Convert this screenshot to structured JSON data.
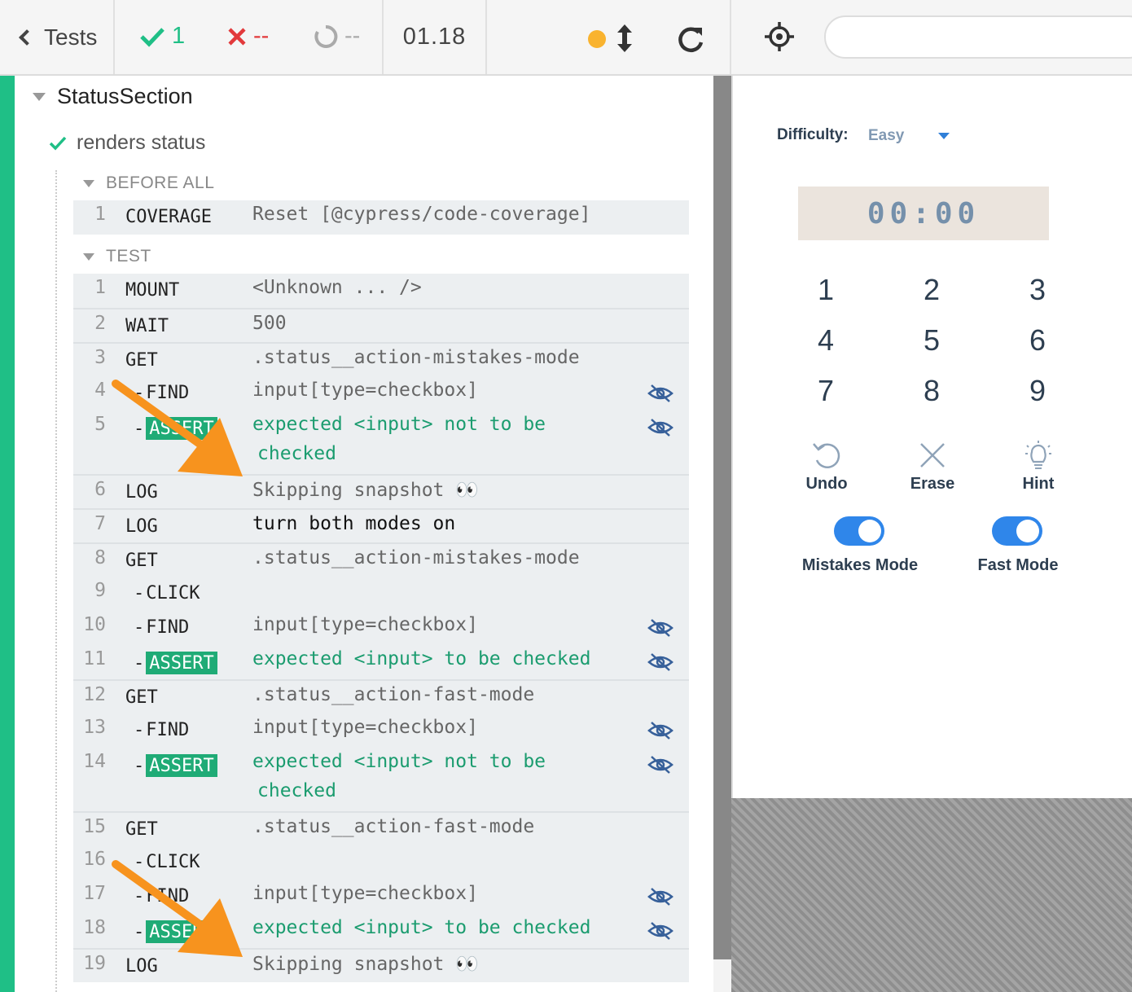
{
  "topbar": {
    "tests_label": "Tests",
    "passed": "1",
    "failed": "--",
    "pending": "--",
    "duration": "01.18",
    "url_value": ""
  },
  "reporter": {
    "suite_title": "StatusSection",
    "test_title": "renders status",
    "hooks": {
      "before_all": "BEFORE ALL",
      "test": "TEST"
    },
    "before_all_commands": [
      {
        "num": "1",
        "name": "COVERAGE",
        "message": "Reset [@cypress/code-coverage]"
      }
    ],
    "commands": [
      {
        "num": "1",
        "name": "MOUNT",
        "message": "<Unknown ... />"
      },
      {
        "num": "2",
        "name": "WAIT",
        "message": "500"
      },
      {
        "num": "3",
        "name": "GET",
        "message": ".status__action-mistakes-mode"
      },
      {
        "num": "4",
        "name": "FIND",
        "message": "input[type=checkbox]"
      },
      {
        "num": "5",
        "name": "ASSERT",
        "message": "expected <input> not to be",
        "message2": "checked"
      },
      {
        "num": "6",
        "name": "LOG",
        "message": "Skipping snapshot 👀"
      },
      {
        "num": "7",
        "name": "LOG",
        "message": "turn both modes on"
      },
      {
        "num": "8",
        "name": "GET",
        "message": ".status__action-mistakes-mode"
      },
      {
        "num": "9",
        "name": "CLICK",
        "message": ""
      },
      {
        "num": "10",
        "name": "FIND",
        "message": "input[type=checkbox]"
      },
      {
        "num": "11",
        "name": "ASSERT",
        "message": "expected <input> to be checked"
      },
      {
        "num": "12",
        "name": "GET",
        "message": ".status__action-fast-mode"
      },
      {
        "num": "13",
        "name": "FIND",
        "message": "input[type=checkbox]"
      },
      {
        "num": "14",
        "name": "ASSERT",
        "message": "expected <input> not to be",
        "message2": "checked"
      },
      {
        "num": "15",
        "name": "GET",
        "message": ".status__action-fast-mode"
      },
      {
        "num": "16",
        "name": "CLICK",
        "message": ""
      },
      {
        "num": "17",
        "name": "FIND",
        "message": "input[type=checkbox]"
      },
      {
        "num": "18",
        "name": "ASSERT",
        "message": "expected <input> to be checked"
      },
      {
        "num": "19",
        "name": "LOG",
        "message": "Skipping snapshot 👀"
      }
    ]
  },
  "app": {
    "difficulty_label": "Difficulty:",
    "difficulty_value": "Easy",
    "timer": "00:00",
    "numbers": [
      "1",
      "2",
      "3",
      "4",
      "5",
      "6",
      "7",
      "8",
      "9"
    ],
    "actions": {
      "undo": "Undo",
      "erase": "Erase",
      "hint": "Hint"
    },
    "modes": {
      "mistakes_label": "Mistakes Mode",
      "mistakes_on": true,
      "fast_label": "Fast Mode",
      "fast_on": true
    }
  },
  "colors": {
    "pass": "#1fbf86",
    "fail": "#e2393b",
    "assert_badge": "#1fab76",
    "arrow_annotation": "#f7931e",
    "toggle_on": "#2f86ea",
    "running_dot": "#f9b32f"
  },
  "icons": [
    "chevron-left-icon",
    "check-icon",
    "x-icon",
    "spinner-icon",
    "dot-icon",
    "arrows-vertical-icon",
    "reload-icon",
    "crosshair-icon",
    "eye-slash-icon",
    "undo-icon",
    "erase-icon",
    "hint-icon"
  ]
}
